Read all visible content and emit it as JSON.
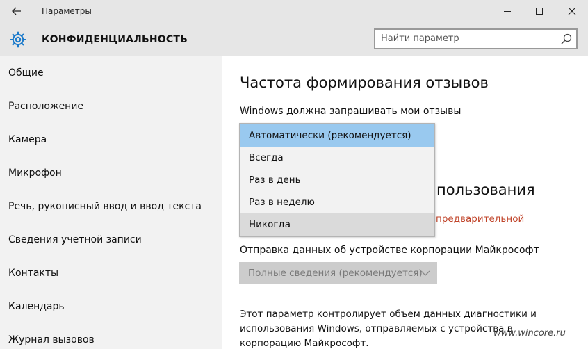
{
  "window": {
    "title": "Параметры"
  },
  "header": {
    "section_title": "КОНФИДЕНЦИАЛЬНОСТЬ",
    "search_placeholder": "Найти параметр"
  },
  "sidebar": {
    "items": [
      {
        "label": "Общие"
      },
      {
        "label": "Расположение"
      },
      {
        "label": "Камера"
      },
      {
        "label": "Микрофон"
      },
      {
        "label": "Речь, рукописный ввод и ввод текста"
      },
      {
        "label": "Сведения учетной записи"
      },
      {
        "label": "Контакты"
      },
      {
        "label": "Календарь"
      },
      {
        "label": "Журнал вызовов"
      }
    ]
  },
  "main": {
    "feedback_heading": "Частота формирования отзывов",
    "feedback_label": "Windows должна запрашивать мои отзывы",
    "dropdown": {
      "options": [
        {
          "label": "Автоматически (рекомендуется)"
        },
        {
          "label": "Всегда"
        },
        {
          "label": "Раз в день"
        },
        {
          "label": "Раз в неделю"
        },
        {
          "label": "Никогда"
        }
      ]
    },
    "usage_heading_partial": "пользования",
    "preview_link_partial": "предварительной",
    "data_label": "Отправка данных об устройстве корпорации Майкрософт",
    "data_combo_value": "Полные сведения (рекомендуется)",
    "description": "Этот параметр контролирует объем данных диагностики и использования Windows, отправляемых с устройства в корпорацию Майкрософт."
  },
  "watermark": "www.wincore.ru",
  "colors": {
    "titlebar_bg": "#e6e6e6",
    "sidebar_bg": "#f2f2f2",
    "accent_blue": "#1979ca",
    "selected_option_bg": "#99c9ef",
    "hover_option_bg": "#dadada",
    "link_red": "#c0442a",
    "disabled_combo_bg": "#cccccc"
  },
  "icons": {
    "back": "back-arrow-icon",
    "minimize": "minimize-icon",
    "maximize": "maximize-icon",
    "close": "close-icon",
    "settings": "gear-icon",
    "search": "search-icon",
    "chevron": "chevron-down-icon"
  }
}
